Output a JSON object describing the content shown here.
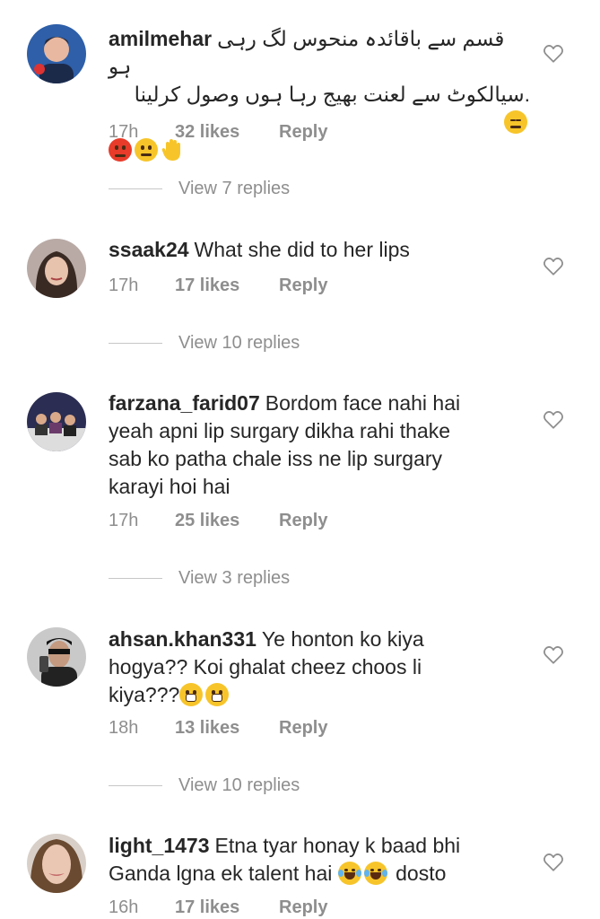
{
  "comments": [
    {
      "username": "amilmehar",
      "text_lines": [
        "قسم سے باقائدہ منحوس لگ رہی ہو",
        ".سیالکوٹ سے لعنت بھیج رہا ہوں وصول کرلینا"
      ],
      "emojis_line1": [
        "expressionless"
      ],
      "emojis_line3": [
        "angry",
        "neutral",
        "raised-hand"
      ],
      "time": "17h",
      "likes": "32 likes",
      "reply": "Reply",
      "view_replies": "View 7 replies"
    },
    {
      "username": "ssaak24",
      "text": "What she did to her lips",
      "time": "17h",
      "likes": "17 likes",
      "reply": "Reply",
      "view_replies": "View 10 replies"
    },
    {
      "username": "farzana_farid07",
      "text_lines": [
        "Bordom face nahi hai",
        "yeah apni lip surgary dikha rahi thake",
        "sab ko patha chale iss ne lip surgary",
        "karayi hoi hai"
      ],
      "time": "17h",
      "likes": "25 likes",
      "reply": "Reply",
      "view_replies": "View 3 replies"
    },
    {
      "username": "ahsan.khan331",
      "text_lines": [
        "Ye honton ko kiya",
        "hogya?? Koi ghalat cheez choos li",
        "kiya???"
      ],
      "emojis": [
        "grimacing",
        "grimacing"
      ],
      "time": "18h",
      "likes": "13 likes",
      "reply": "Reply",
      "view_replies": "View 10 replies"
    },
    {
      "username": "light_1473",
      "text_lines": [
        "Etna tyar honay k baad bhi",
        "Ganda lgna ek talent hai",
        "dosto"
      ],
      "emojis": [
        "tears-of-joy",
        "tears-of-joy"
      ],
      "time": "16h",
      "likes": "17 likes",
      "reply": "Reply"
    }
  ],
  "icons": {
    "like": "heart-outline-icon"
  },
  "colors": {
    "text": "#262626",
    "meta": "#8e8e8e",
    "divider": "#c7c7c7"
  }
}
